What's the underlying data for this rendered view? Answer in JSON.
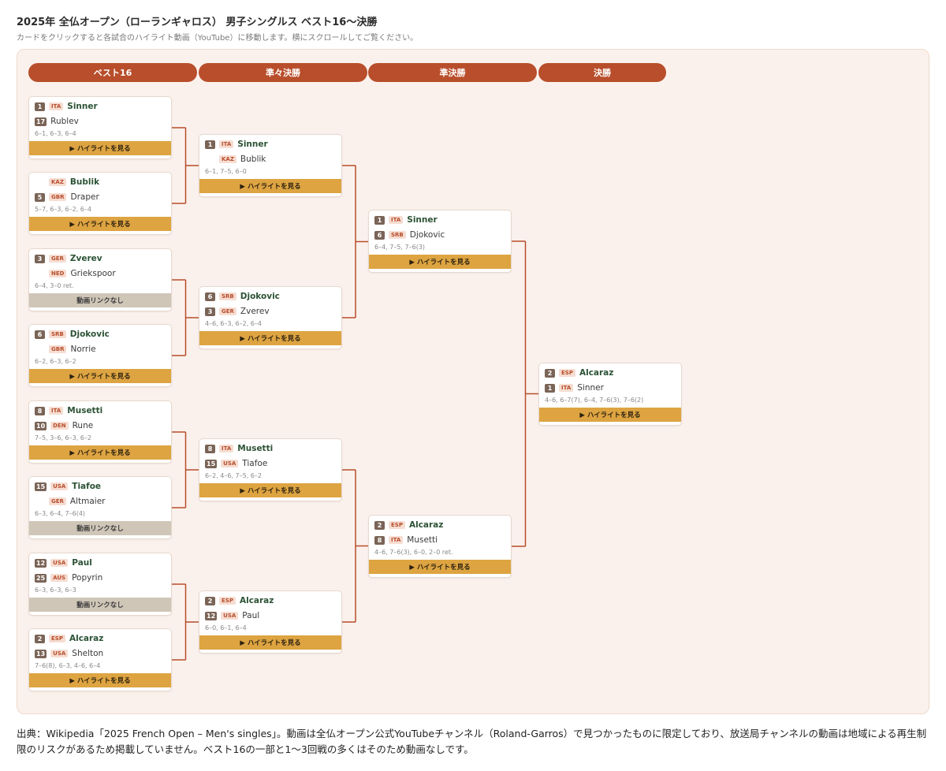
{
  "page": {
    "title": "2025年 全仏オープン（ローランギャロス） 男子シングルス ベスト16〜決勝",
    "subtitle": "カードをクリックすると各試合のハイライト動画（YouTube）に移動します。横にスクロールしてご覧ください。"
  },
  "rounds": [
    "ベスト16",
    "準々決勝",
    "準決勝",
    "決勝"
  ],
  "labels": {
    "highlight": "▶ ハイライトを見る",
    "no_video": "動画リンクなし"
  },
  "colors": {
    "accent": "#b84e2b",
    "highlight_button": "#dda441",
    "no_video_button": "#cfc6b8",
    "winner_name": "#2c5235"
  },
  "matches": [
    {
      "winner": {
        "seed": "1",
        "country": "ITA",
        "name": "Sinner"
      },
      "loser": {
        "seed": "17",
        "country": "",
        "name": "Rublev"
      },
      "score": "6–1, 6–3, 6–4",
      "video": true
    },
    {
      "winner": {
        "seed": "",
        "country": "KAZ",
        "name": "Bublik"
      },
      "loser": {
        "seed": "5",
        "country": "GBR",
        "name": "Draper"
      },
      "score": "5–7, 6–3, 6–2, 6–4",
      "video": true
    },
    {
      "winner": {
        "seed": "3",
        "country": "GER",
        "name": "Zverev"
      },
      "loser": {
        "seed": "",
        "country": "NED",
        "name": "Griekspoor"
      },
      "score": "6–4, 3–0 ret.",
      "video": false
    },
    {
      "winner": {
        "seed": "6",
        "country": "SRB",
        "name": "Djokovic"
      },
      "loser": {
        "seed": "",
        "country": "GBR",
        "name": "Norrie"
      },
      "score": "6–2, 6–3, 6–2",
      "video": true
    },
    {
      "winner": {
        "seed": "8",
        "country": "ITA",
        "name": "Musetti"
      },
      "loser": {
        "seed": "10",
        "country": "DEN",
        "name": "Rune"
      },
      "score": "7–5, 3–6, 6–3, 6–2",
      "video": true
    },
    {
      "winner": {
        "seed": "15",
        "country": "USA",
        "name": "Tiafoe"
      },
      "loser": {
        "seed": "",
        "country": "GER",
        "name": "Altmaier"
      },
      "score": "6–3, 6–4, 7–6(4)",
      "video": false
    },
    {
      "winner": {
        "seed": "12",
        "country": "USA",
        "name": "Paul"
      },
      "loser": {
        "seed": "25",
        "country": "AUS",
        "name": "Popyrin"
      },
      "score": "6–3, 6–3, 6–3",
      "video": false
    },
    {
      "winner": {
        "seed": "2",
        "country": "ESP",
        "name": "Alcaraz"
      },
      "loser": {
        "seed": "13",
        "country": "USA",
        "name": "Shelton"
      },
      "score": "7–6(8), 6–3, 4–6, 6–4",
      "video": true
    },
    {
      "winner": {
        "seed": "1",
        "country": "ITA",
        "name": "Sinner"
      },
      "loser": {
        "seed": "",
        "country": "KAZ",
        "name": "Bublik"
      },
      "score": "6–1, 7–5, 6–0",
      "video": true
    },
    {
      "winner": {
        "seed": "6",
        "country": "SRB",
        "name": "Djokovic"
      },
      "loser": {
        "seed": "3",
        "country": "GER",
        "name": "Zverev"
      },
      "score": "4–6, 6–3, 6–2, 6–4",
      "video": true
    },
    {
      "winner": {
        "seed": "8",
        "country": "ITA",
        "name": "Musetti"
      },
      "loser": {
        "seed": "15",
        "country": "USA",
        "name": "Tiafoe"
      },
      "score": "6–2, 4–6, 7–5, 6–2",
      "video": true
    },
    {
      "winner": {
        "seed": "2",
        "country": "ESP",
        "name": "Alcaraz"
      },
      "loser": {
        "seed": "12",
        "country": "USA",
        "name": "Paul"
      },
      "score": "6–0, 6–1, 6–4",
      "video": true
    },
    {
      "winner": {
        "seed": "1",
        "country": "ITA",
        "name": "Sinner"
      },
      "loser": {
        "seed": "6",
        "country": "SRB",
        "name": "Djokovic"
      },
      "score": "6–4, 7–5, 7–6(3)",
      "video": true
    },
    {
      "winner": {
        "seed": "2",
        "country": "ESP",
        "name": "Alcaraz"
      },
      "loser": {
        "seed": "8",
        "country": "ITA",
        "name": "Musetti"
      },
      "score": "4–6, 7–6(3), 6–0, 2–0 ret.",
      "video": true
    },
    {
      "winner": {
        "seed": "2",
        "country": "ESP",
        "name": "Alcaraz"
      },
      "loser": {
        "seed": "1",
        "country": "ITA",
        "name": "Sinner"
      },
      "score": "4–6, 6–7(7), 6–4, 7–6(3), 7–6(2)",
      "video": true
    }
  ],
  "footnote": "出典：Wikipedia「2025 French Open – Men's singles」。動画は全仏オープン公式YouTubeチャンネル（Roland-Garros）で見つかったものに限定しており、放送局チャンネルの動画は地域による再生制限のリスクがあるため掲載していません。ベスト16の一部と1〜3回戦の多くはそのため動画なしです。"
}
